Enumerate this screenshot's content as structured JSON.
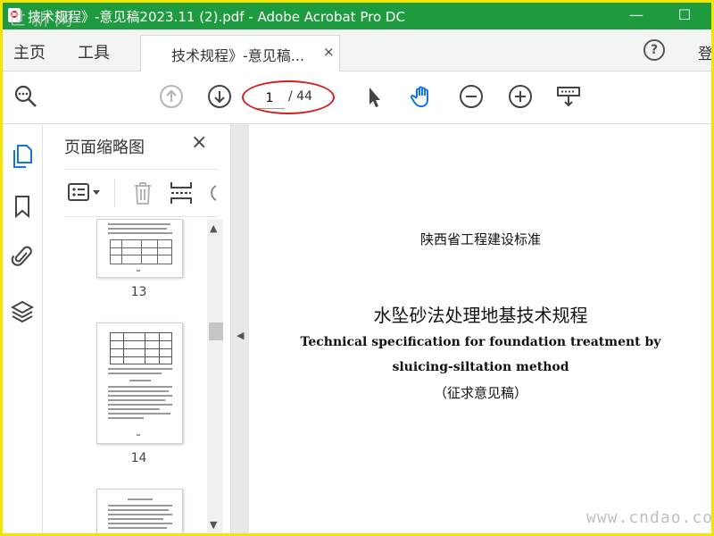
{
  "window": {
    "title": "技术规程》-意见稿2023.11 (2).pdf - Adobe Acrobat Pro DC",
    "minimize": "—",
    "maximize": "☐"
  },
  "tabs": {
    "home": "主页",
    "tools": "工具",
    "document_tab": "技术规程》-意见稿...",
    "close_glyph": "×",
    "help": "?",
    "login": "登"
  },
  "toolbar": {
    "page_current": "1",
    "page_total": "/ 44",
    "icons": [
      "search-zoom-icon",
      "prev-page-icon",
      "next-page-icon",
      "select-cursor-icon",
      "hand-tool-icon",
      "zoom-out-icon",
      "zoom-in-icon",
      "keyboard-scroll-icon"
    ]
  },
  "panel": {
    "title": "页面缩略图",
    "close_glyph": "×",
    "thumbnails": [
      {
        "label": "13"
      },
      {
        "label": "14"
      }
    ]
  },
  "document": {
    "line1": "陕西省工程建设标准",
    "line2": "水坠砂法处理地基技术规程",
    "line3": "Technical specification for foundation treatment by",
    "line4": "sluicing-siltation method",
    "line5": "（征求意见稿）"
  },
  "watermarks": {
    "top": "世新网",
    "bottom": "www.cndao.com"
  },
  "colors": {
    "titlebar": "#1e9a3f",
    "frame_border": "#f2e600",
    "annotation_red": "#d91d1d",
    "hand_tool_blue": "#1473e6"
  }
}
